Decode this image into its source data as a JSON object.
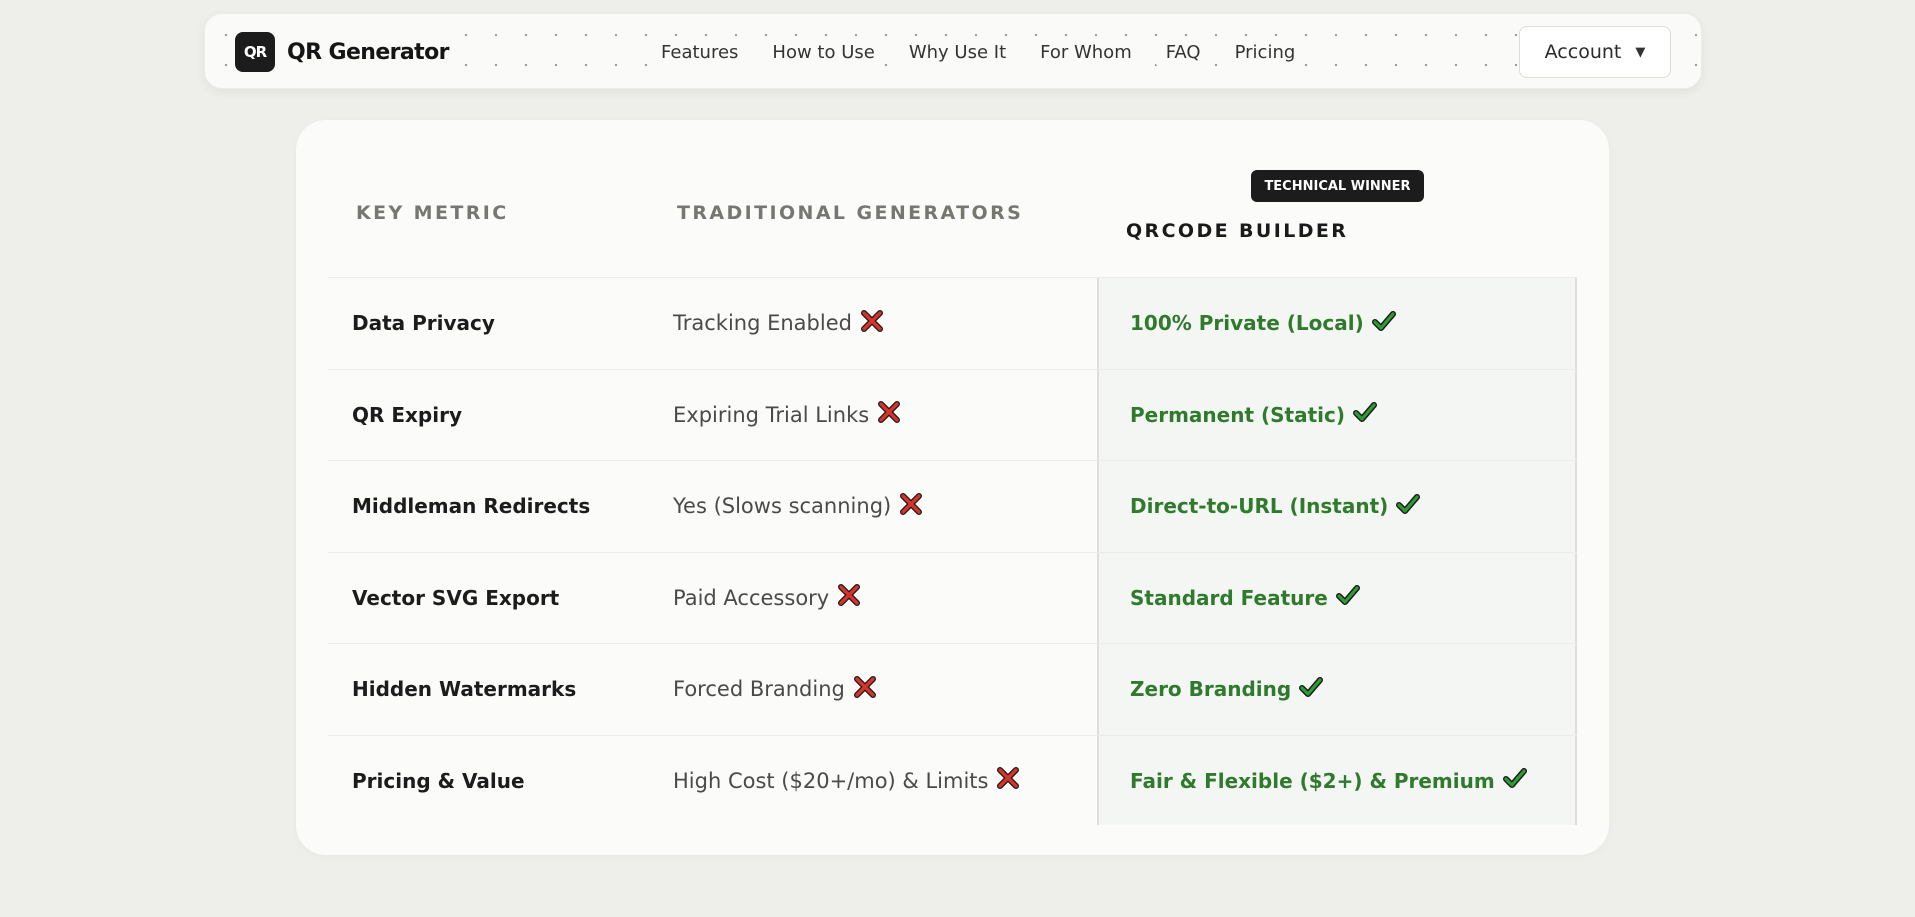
{
  "header": {
    "logo_text": "QR",
    "brand_name": "QR Generator",
    "nav": [
      "Features",
      "How to Use",
      "Why Use It",
      "For Whom",
      "FAQ",
      "Pricing"
    ],
    "account_label": "Account"
  },
  "comparison": {
    "badge": "TECHNICAL WINNER",
    "columns": [
      "KEY METRIC",
      "TRADITIONAL GENERATORS",
      "QRCODE BUILDER"
    ],
    "rows": [
      {
        "metric": "Data Privacy",
        "traditional": "Tracking Enabled",
        "builder": "100% Private (Local)"
      },
      {
        "metric": "QR Expiry",
        "traditional": "Expiring Trial Links",
        "builder": "Permanent (Static)"
      },
      {
        "metric": "Middleman Redirects",
        "traditional": "Yes (Slows scanning)",
        "builder": "Direct-to-URL (Instant)"
      },
      {
        "metric": "Vector SVG Export",
        "traditional": "Paid Accessory",
        "builder": "Standard Feature"
      },
      {
        "metric": "Hidden Watermarks",
        "traditional": "Forced Branding",
        "builder": "Zero Branding"
      },
      {
        "metric": "Pricing & Value",
        "traditional": "High Cost ($20+/mo) & Limits",
        "builder": "Fair & Flexible ($2+) & Premium"
      }
    ],
    "icons": {
      "traditional": "cross-mark-icon",
      "builder": "check-mark-icon"
    },
    "colors": {
      "winner_text": "#2f7a2c",
      "cross": "#d9322b",
      "check": "#2e9b33"
    }
  }
}
